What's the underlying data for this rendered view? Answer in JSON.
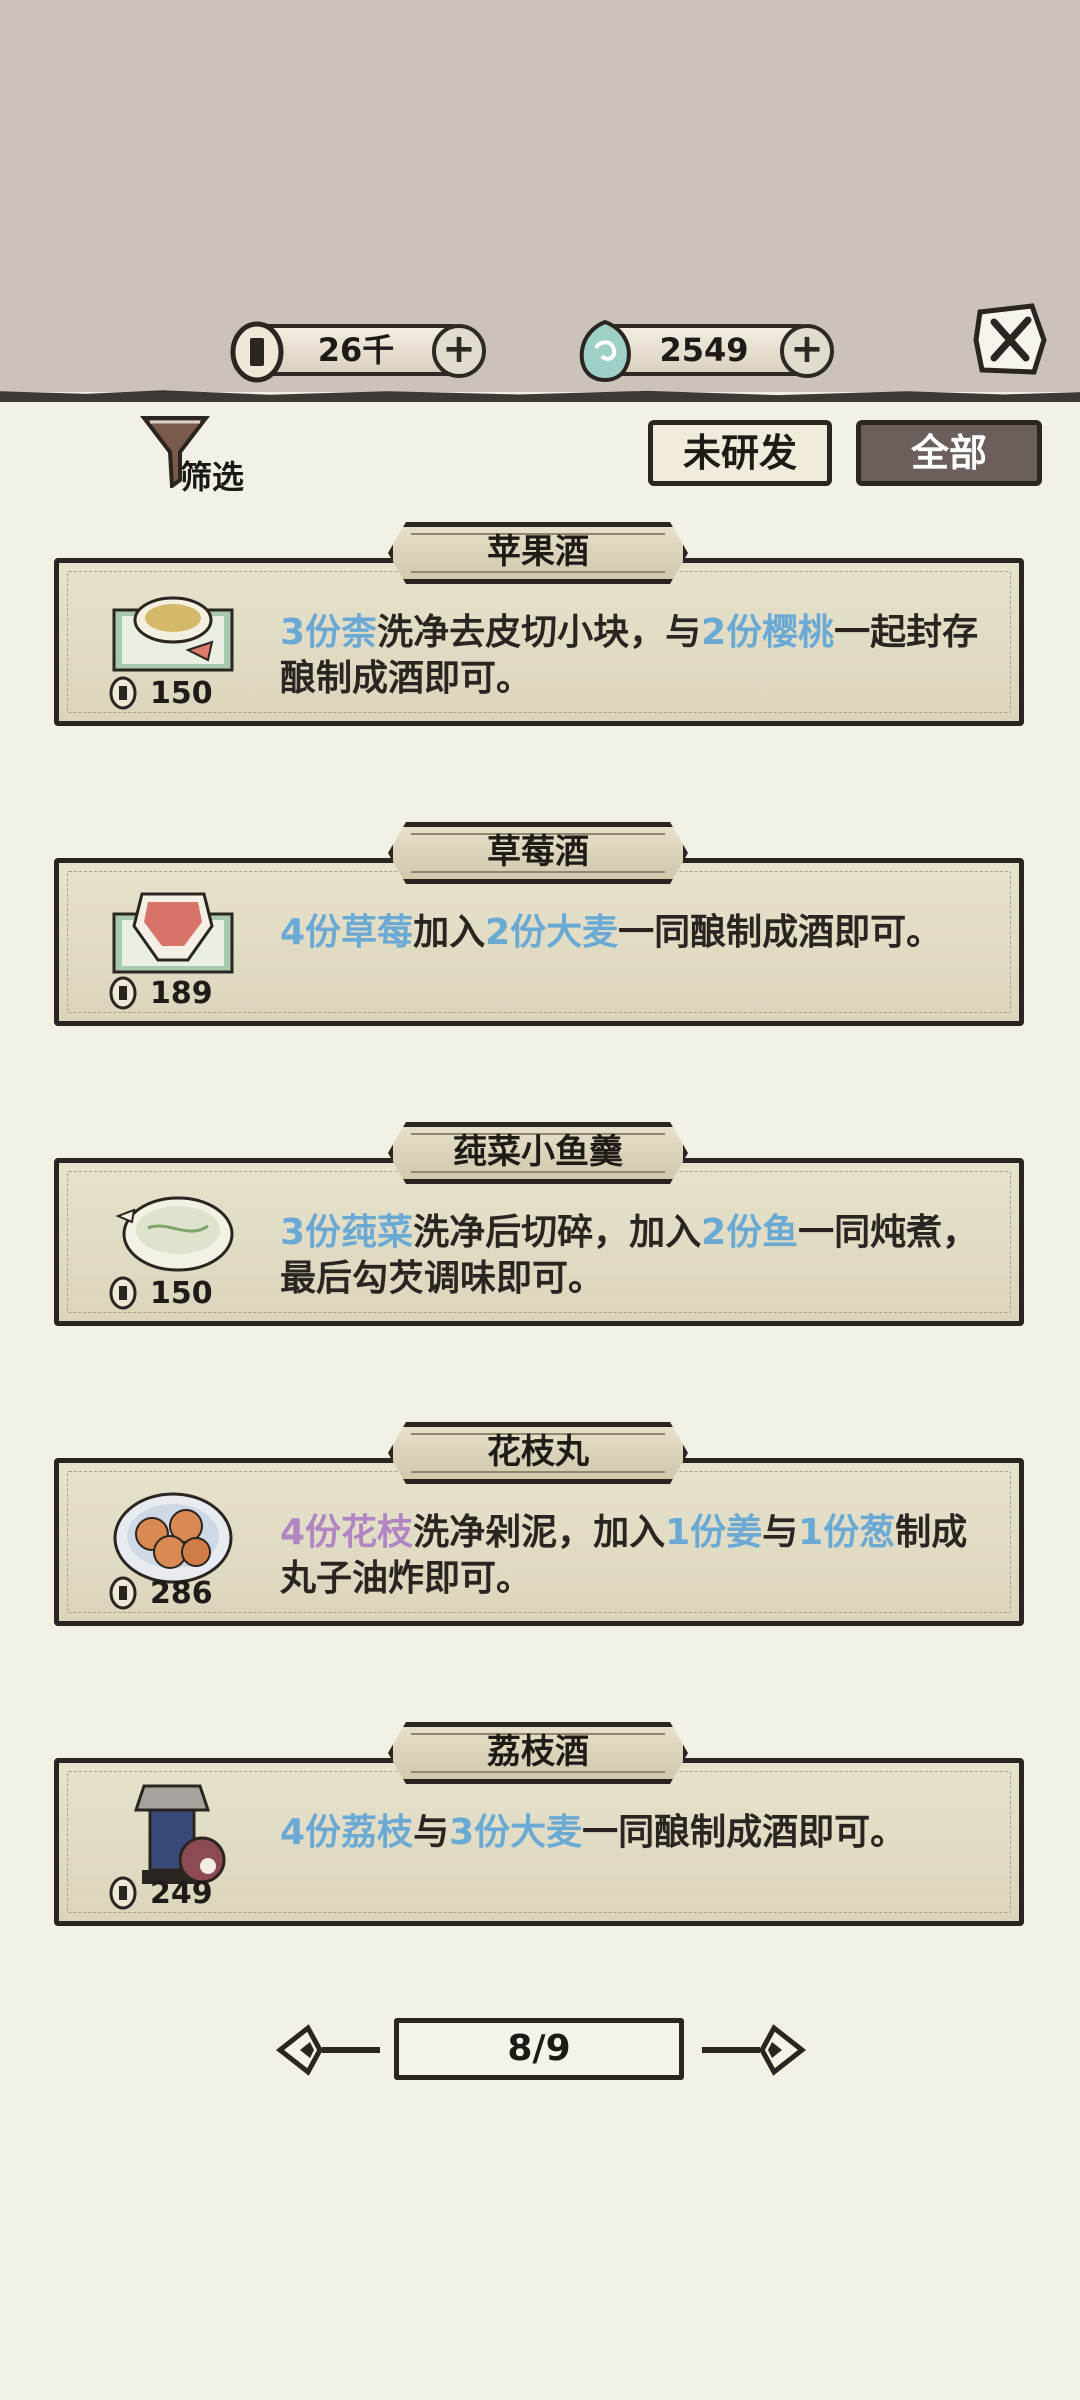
{
  "currency": {
    "coins": "26千",
    "gems": "2549"
  },
  "filter": {
    "label": "筛选"
  },
  "tabs": {
    "unresearched": "未研发",
    "all": "全部"
  },
  "recipes": [
    {
      "title": "苹果酒",
      "price": "150",
      "desc": [
        {
          "t": "3份柰",
          "c": "blue"
        },
        {
          "t": "洗净去皮切小块，与",
          "c": ""
        },
        {
          "t": "2份樱桃",
          "c": "blue"
        },
        {
          "t": "一起封存酿制成酒即可。",
          "c": ""
        }
      ]
    },
    {
      "title": "草莓酒",
      "price": "189",
      "desc": [
        {
          "t": "4份草莓",
          "c": "blue"
        },
        {
          "t": "加入",
          "c": ""
        },
        {
          "t": "2份大麦",
          "c": "blue"
        },
        {
          "t": "一同酿制成酒即可。",
          "c": ""
        }
      ]
    },
    {
      "title": "莼菜小鱼羹",
      "price": "150",
      "desc": [
        {
          "t": "3份莼菜",
          "c": "blue"
        },
        {
          "t": "洗净后切碎，加入",
          "c": ""
        },
        {
          "t": "2份鱼",
          "c": "blue"
        },
        {
          "t": "一同炖煮，最后勾芡调味即可。",
          "c": ""
        }
      ]
    },
    {
      "title": "花枝丸",
      "price": "286",
      "desc": [
        {
          "t": "4份花枝",
          "c": "purple"
        },
        {
          "t": "洗净剁泥，加入",
          "c": ""
        },
        {
          "t": "1份姜",
          "c": "blue"
        },
        {
          "t": "与",
          "c": ""
        },
        {
          "t": "1份葱",
          "c": "blue"
        },
        {
          "t": "制成丸子油炸即可。",
          "c": ""
        }
      ]
    },
    {
      "title": "荔枝酒",
      "price": "249",
      "desc": [
        {
          "t": "4份荔枝",
          "c": "blue"
        },
        {
          "t": "与",
          "c": ""
        },
        {
          "t": "3份大麦",
          "c": "blue"
        },
        {
          "t": "一同酿制成酒即可。",
          "c": ""
        }
      ]
    }
  ],
  "pagination": {
    "label": "8/9"
  },
  "colors": {
    "highlight_blue": "#6aa9d4",
    "highlight_purple": "#b184c2",
    "tab_active": "#6b5f5c"
  }
}
